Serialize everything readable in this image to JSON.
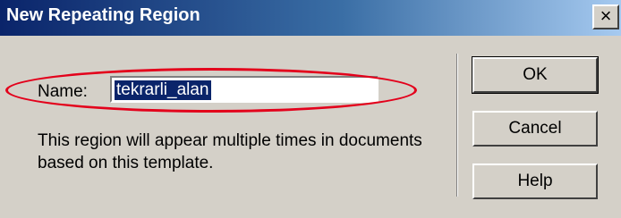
{
  "window": {
    "title": "New Repeating Region",
    "close_glyph": "×"
  },
  "form": {
    "name_label": "Name:",
    "name_value": "tekrarli_alan",
    "description": "This region will appear multiple times in documents based on this template."
  },
  "buttons": {
    "ok": "OK",
    "cancel": "Cancel",
    "help": "Help"
  },
  "colors": {
    "title_gradient_start": "#0a246a",
    "title_gradient_end": "#a6caf0",
    "highlight_ellipse": "#e3001b",
    "dialog_background": "#d4d0c8"
  }
}
